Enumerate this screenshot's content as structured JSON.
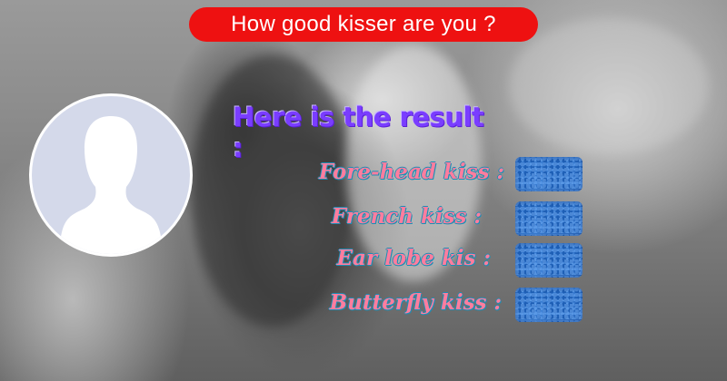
{
  "app": {
    "title": "How good kisser are you ?",
    "accent": "#ee1111"
  },
  "avatar": {
    "icon": "default-profile-silhouette-icon",
    "fill": "#d4d9ea",
    "silhouette": "#ffffff"
  },
  "result": {
    "heading": "Here is the result :",
    "heading_color": "#7a3dff",
    "label_color": "#ff7d9e",
    "box_color": "#2f72c8",
    "items": [
      {
        "label": "Fore-head kiss :"
      },
      {
        "label": "French kiss :"
      },
      {
        "label": "Ear lobe kis :"
      },
      {
        "label": "Butterfly kiss :"
      }
    ]
  }
}
